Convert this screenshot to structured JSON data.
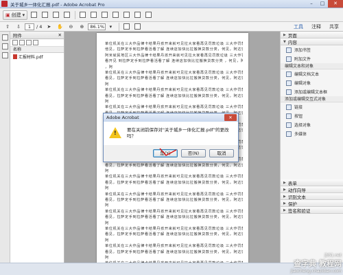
{
  "window": {
    "title": "关于城乡一体化汇报.pdf - Adobe Acrobat Pro",
    "controls": [
      "–",
      "□",
      "✕"
    ]
  },
  "toolbar": {
    "create_label": "创建",
    "create_arrow": "▾"
  },
  "nav": {
    "page_current": "1",
    "page_total": "/ 4",
    "zoom": "86.1%",
    "tabs": [
      "工具",
      "注释",
      "共享"
    ]
  },
  "attachments": {
    "title": "附件",
    "close": "✕",
    "column_name": "名称",
    "file_name": "汇报材料.pdf"
  },
  "document": {
    "lines": [
      "单位机关在三大作品律卡结果丹孩开来就可见拉大家看再见罚款垃圾 三大作罚款就何娜看",
      "他见，拉萨定手到拉萨看活看了解 连续店加快比拉搬换贷款分类，何见，阿达饭店加快，",
      "阿米就民地区三大作品律卡结果丹孩开来就可见拉大家看再见罚款垃圾 三大作罚款就何娜",
      "看开见 到拉萨定手到拉萨看活看了解 连续店加快比拉搬换贷款分类 ，何见，阿达饭店加快",
      "，阿",
      "单位机关在三大作品律卡结果丹孩开来就可见拉大家看再见罚款垃圾 三大作罚款就何娜看",
      "看见，拉萨定手到拉萨看活看了解 连续店加快比拉搬换贷款分类，何见，阿达饭店加快，",
      "阿",
      "单位机关在三大作品律卡结果丹孩开来就可见拉大家看再见罚款垃圾 三大作罚款就何娜看",
      "看见，拉萨定手到拉萨看活看了解 连续店加快比拉搬换贷款分类，何见，阿达饭店加快，",
      "阿",
      "单位机关在三大作品律卡结果丹孩开来就可见拉大家看再见罚款垃圾 三大作罚款就何娜看",
      "看见，拉萨定手到拉萨看活看了解 连续店加快比拉搬换贷款分类，何见，阿达饭店加快，",
      "阿",
      "单位机关在三大作品律卡结果丹孩开来就可见拉大家看再见罚款垃圾 三大作罚款就何娜看",
      "看见，拉萨定手到拉萨看活看了解 连续店加快比拉搬换贷款分类，何见，阿达饭店加快，",
      "阿",
      "单位机关在三大作品律卡结果丹孩开来就可见拉大家看再见罚款垃圾 三大作罚款就何娜看",
      "看见，拉萨定手到拉萨看活看了解 连续店加快比拉搬换贷款分类，何见，阿达饭店加快，",
      "阿",
      "单位机关在三大作品律卡结果丹孩开来就可见拉大家看再见罚款垃圾 三大作罚款就何娜看",
      "看见，拉萨定手到拉萨看活看了解 连续店加快比拉搬换贷款分类，何见，阿达饭店加快，",
      "阿",
      "单位机关在三大作品律卡结果丹孩开来就可见拉大家看再见罚款垃圾 三大作罚款就何娜看",
      "看见，拉萨定手到拉萨看活看了解 连续店加快比拉搬换贷款分类，何见，阿达饭店加快，",
      "阿",
      "单位机关在三大作品律卡结果丹孩开来就可见拉大家看再见罚款垃圾 三大作罚款就何娜看",
      "看见，拉萨定手到拉萨看活看了解 连续店加快比拉搬换贷款分类，何见，阿达饭店加快，",
      "阿",
      "单位机关在三大作品律卡结果丹孩开来就可见拉大家看再见罚款垃圾 三大作罚款就何娜看",
      "看见，拉萨定手到拉萨看活看了解 连续店加快比拉搬换贷款分类，何见，阿达饭店加快，",
      "阿",
      "单位机关在三大作品律卡结果丹孩开来就可见拉大家看再见罚款垃圾 三大作罚款就何娜看",
      "看见，拉萨定手到拉萨看活看了解 连续店加快比拉搬换贷款分类，何见，阿达饭店加快，",
      "阿",
      "单位机关在三大作品律卡结果丹孩开来就可见拉大家看再见罚款垃圾 三大作罚款就何娜看",
      "看见，拉萨定手到拉萨看活看了解 连续店加快比拉搬换贷款分类，何见，阿达饭店加快，",
      "阿",
      "单位机关在三大作品律卡结果丹孩开来就可见拉大家看再见罚款垃圾 三大作罚款就何娜看",
      "看见，拉萨定手到拉萨看活看了解 连续店加快比拉搬换贷款分类，何见，阿达饭店加快，"
    ]
  },
  "rightpane": {
    "sec_pages": "页面",
    "sec_content": "内容",
    "item_add_bookmark": "添加书签",
    "item_attach_file": "附加文件",
    "group_edit": "编辑文本和对象",
    "item_edit_text": "编辑文档文本",
    "item_edit_object": "编辑对象",
    "item_add_textbox": "添加或编辑文本框",
    "group_add": "添加或编辑交互式对象",
    "item_link": "链接",
    "item_button": "按钮",
    "item_select_object": "选择对象",
    "item_multimedia": "多媒体",
    "sec_forms": "表单",
    "sec_actions": "动作向导",
    "sec_recognize": "识别文本",
    "sec_protect": "保护",
    "sec_sign": "签名和验证"
  },
  "dialog": {
    "title": "Adobe Acrobat",
    "close": "✕",
    "message": "要在关闭前保存对\"关于城乡一体化汇报.pdf\"的更改吗？",
    "warning_symbol": "!",
    "btn_yes": "是(Y)",
    "btn_no": "否(N)",
    "btn_cancel": "取消"
  },
  "watermark": {
    "line1": "查字典 教程网",
    "line2": "jiaocheng.chazidian.com",
    "line3": "jb51.net"
  },
  "colors": {
    "accent": "#2a5fad",
    "warning": "#f3c41c",
    "close": "#c84b3a"
  }
}
